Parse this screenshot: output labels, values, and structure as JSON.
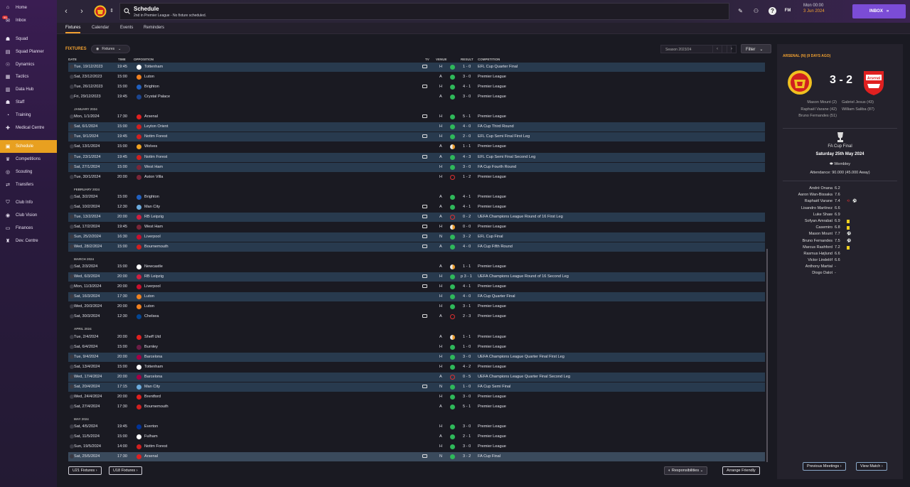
{
  "sidebar": {
    "items": [
      {
        "label": "Home",
        "icon": "home-icon",
        "glyph": "⌂"
      },
      {
        "label": "Inbox",
        "icon": "inbox-icon",
        "glyph": "✉"
      },
      {
        "label": "Squad",
        "icon": "squad-icon",
        "glyph": "☗"
      },
      {
        "label": "Squad Planner",
        "icon": "squad-planner-icon",
        "glyph": "▤"
      },
      {
        "label": "Dynamics",
        "icon": "dynamics-icon",
        "glyph": "☉"
      },
      {
        "label": "Tactics",
        "icon": "tactics-icon",
        "glyph": "▦"
      },
      {
        "label": "Data Hub",
        "icon": "data-hub-icon",
        "glyph": "▥"
      },
      {
        "label": "Staff",
        "icon": "staff-icon",
        "glyph": "☗"
      },
      {
        "label": "Training",
        "icon": "training-icon",
        "glyph": "◔"
      },
      {
        "label": "Medical Centre",
        "icon": "medical-icon",
        "glyph": "✚"
      },
      {
        "label": "Schedule",
        "icon": "calendar-icon",
        "glyph": "▣"
      },
      {
        "label": "Competitions",
        "icon": "trophy-icon",
        "glyph": "♛"
      },
      {
        "label": "Scouting",
        "icon": "scouting-icon",
        "glyph": "◎"
      },
      {
        "label": "Transfers",
        "icon": "transfers-icon",
        "glyph": "⇄"
      },
      {
        "label": "Club Info",
        "icon": "club-info-icon",
        "glyph": "⛉"
      },
      {
        "label": "Club Vision",
        "icon": "club-vision-icon",
        "glyph": "◉"
      },
      {
        "label": "Finances",
        "icon": "finances-icon",
        "glyph": "▭"
      },
      {
        "label": "Dev. Centre",
        "icon": "dev-centre-icon",
        "glyph": "♜"
      }
    ],
    "inbox_badge": "99"
  },
  "header": {
    "title": "Schedule",
    "subtitle": "2nd in Premier League - No fixture scheduled.",
    "date_time": "Mon 00:00",
    "date_day": "3 Jun 2024",
    "inbox_label": "INBOX",
    "fm_label": "FM"
  },
  "tabs": [
    "Fixtures",
    "Calendar",
    "Events",
    "Reminders"
  ],
  "fixtures": {
    "title": "FIXTURES",
    "dropdown": "Fixtures",
    "season": "Season 2023/24",
    "filter": "Filter",
    "columns": {
      "date": "DATE",
      "time": "TIME",
      "opposition": "OPPOSITION",
      "tv": "TV",
      "venue": "VENUE",
      "result": "RESULT",
      "competition": "COMPETITION"
    },
    "rows": [
      {
        "type": "row",
        "date": "Tue, 19/12/2023",
        "time": "19:45",
        "opp": "Tottenham",
        "crest": "#ffffff",
        "tv": true,
        "venue": "H",
        "res": "w",
        "score": "1 - 0",
        "comp": "EFL Cup Quarter Final",
        "hl": true
      },
      {
        "type": "row",
        "date": "Sat, 23/12/2023",
        "time": "15:00",
        "opp": "Luton",
        "crest": "#f08020",
        "tv": false,
        "venue": "A",
        "res": "w",
        "score": "3 - 0",
        "comp": "Premier League",
        "hl": false
      },
      {
        "type": "row",
        "date": "Tue, 26/12/2023",
        "time": "15:00",
        "opp": "Brighton",
        "crest": "#2060c0",
        "tv": true,
        "venue": "H",
        "res": "w",
        "score": "4 - 1",
        "comp": "Premier League",
        "hl": false
      },
      {
        "type": "row",
        "date": "Fri, 29/12/2023",
        "time": "19:45",
        "opp": "Crystal Palace",
        "crest": "#1b458f",
        "tv": false,
        "venue": "A",
        "res": "w",
        "score": "3 - 0",
        "comp": "Premier League",
        "hl": false
      },
      {
        "type": "month",
        "label": "JANUARY 2024"
      },
      {
        "type": "row",
        "date": "Mon, 1/1/2024",
        "time": "17:30",
        "opp": "Arsenal",
        "crest": "#e02020",
        "tv": true,
        "venue": "H",
        "res": "w",
        "score": "5 - 1",
        "comp": "Premier League",
        "hl": false
      },
      {
        "type": "row",
        "date": "Sat, 6/1/2024",
        "time": "15:00",
        "opp": "Leyton Orient",
        "crest": "#d02020",
        "tv": false,
        "venue": "H",
        "res": "w",
        "score": "4 - 0",
        "comp": "FA Cup Third Round",
        "hl": true
      },
      {
        "type": "row",
        "date": "Tue, 9/1/2024",
        "time": "19:45",
        "opp": "Nottm Forest",
        "crest": "#d02020",
        "tv": true,
        "venue": "H",
        "res": "w",
        "score": "2 - 0",
        "comp": "EFL Cup Semi Final First Leg",
        "hl": true
      },
      {
        "type": "row",
        "date": "Sat, 13/1/2024",
        "time": "15:00",
        "opp": "Wolves",
        "crest": "#f0a020",
        "tv": false,
        "venue": "A",
        "res": "d",
        "score": "1 - 1",
        "comp": "Premier League",
        "hl": false
      },
      {
        "type": "row",
        "date": "Tue, 23/1/2024",
        "time": "19:45",
        "opp": "Nottm Forest",
        "crest": "#d02020",
        "tv": true,
        "venue": "A",
        "res": "w",
        "score": "4 - 3",
        "comp": "EFL Cup Semi Final Second Leg",
        "hl": true
      },
      {
        "type": "row",
        "date": "Sat, 27/1/2024",
        "time": "15:00",
        "opp": "West Ham",
        "crest": "#7a2638",
        "tv": false,
        "venue": "H",
        "res": "w",
        "score": "3 - 0",
        "comp": "FA Cup Fourth Round",
        "hl": true
      },
      {
        "type": "row",
        "date": "Tue, 30/1/2024",
        "time": "20:00",
        "opp": "Aston Villa",
        "crest": "#7a2638",
        "tv": false,
        "venue": "H",
        "res": "l",
        "score": "1 - 2",
        "comp": "Premier League",
        "hl": false
      },
      {
        "type": "month",
        "label": "FEBRUARY 2024"
      },
      {
        "type": "row",
        "date": "Sat, 3/2/2024",
        "time": "15:00",
        "opp": "Brighton",
        "crest": "#2060c0",
        "tv": false,
        "venue": "A",
        "res": "w",
        "score": "4 - 1",
        "comp": "Premier League",
        "hl": false
      },
      {
        "type": "row",
        "date": "Sat, 10/2/2024",
        "time": "12:30",
        "opp": "Man City",
        "crest": "#6cabdd",
        "tv": true,
        "venue": "A",
        "res": "w",
        "score": "4 - 1",
        "comp": "Premier League",
        "hl": false
      },
      {
        "type": "row",
        "date": "Tue, 13/2/2024",
        "time": "20:00",
        "opp": "RB Leipzig",
        "crest": "#d02040",
        "tv": true,
        "venue": "A",
        "res": "l",
        "score": "0 - 2",
        "comp": "UEFA Champions League Round of 16 First Leg",
        "hl": true
      },
      {
        "type": "row",
        "date": "Sat, 17/2/2024",
        "time": "19:45",
        "opp": "West Ham",
        "crest": "#7a2638",
        "tv": true,
        "venue": "H",
        "res": "d",
        "score": "0 - 0",
        "comp": "Premier League",
        "hl": false
      },
      {
        "type": "row",
        "date": "Sun, 25/2/2024",
        "time": "16:30",
        "opp": "Liverpool",
        "crest": "#c8102e",
        "tv": true,
        "venue": "N",
        "res": "w",
        "score": "3 - 2",
        "comp": "EFL Cup Final",
        "hl": true
      },
      {
        "type": "row",
        "date": "Wed, 28/2/2024",
        "time": "15:00",
        "opp": "Bournemouth",
        "crest": "#d02020",
        "tv": true,
        "venue": "A",
        "res": "w",
        "score": "4 - 0",
        "comp": "FA Cup Fifth Round",
        "hl": true
      },
      {
        "type": "month",
        "label": "MARCH 2024"
      },
      {
        "type": "row",
        "date": "Sat, 2/3/2024",
        "time": "15:00",
        "opp": "Newcastle",
        "crest": "#ffffff",
        "tv": false,
        "venue": "A",
        "res": "d",
        "score": "1 - 1",
        "comp": "Premier League",
        "hl": false
      },
      {
        "type": "row",
        "date": "Wed, 6/3/2024",
        "time": "20:00",
        "opp": "RB Leipzig",
        "crest": "#d02040",
        "tv": true,
        "venue": "H",
        "res": "w",
        "score": "p 3 - 1",
        "comp": "UEFA Champions League Round of 16 Second Leg",
        "hl": true
      },
      {
        "type": "row",
        "date": "Mon, 11/3/2024",
        "time": "20:00",
        "opp": "Liverpool",
        "crest": "#c8102e",
        "tv": true,
        "venue": "H",
        "res": "w",
        "score": "4 - 1",
        "comp": "Premier League",
        "hl": false
      },
      {
        "type": "row",
        "date": "Sat, 16/3/2024",
        "time": "17:30",
        "opp": "Luton",
        "crest": "#f08020",
        "tv": false,
        "venue": "H",
        "res": "w",
        "score": "4 - 0",
        "comp": "FA Cup Quarter Final",
        "hl": true
      },
      {
        "type": "row",
        "date": "Wed, 20/3/2024",
        "time": "20:00",
        "opp": "Luton",
        "crest": "#f08020",
        "tv": false,
        "venue": "H",
        "res": "w",
        "score": "3 - 1",
        "comp": "Premier League",
        "hl": false
      },
      {
        "type": "row",
        "date": "Sat, 30/3/2024",
        "time": "12:30",
        "opp": "Chelsea",
        "crest": "#034694",
        "tv": true,
        "venue": "A",
        "res": "l",
        "score": "2 - 3",
        "comp": "Premier League",
        "hl": false
      },
      {
        "type": "month",
        "label": "APRIL 2024"
      },
      {
        "type": "row",
        "date": "Tue, 2/4/2024",
        "time": "20:00",
        "opp": "Sheff Utd",
        "crest": "#e02020",
        "tv": false,
        "venue": "A",
        "res": "d",
        "score": "1 - 1",
        "comp": "Premier League",
        "hl": false
      },
      {
        "type": "row",
        "date": "Sat, 6/4/2024",
        "time": "15:00",
        "opp": "Burnley",
        "crest": "#6c1d45",
        "tv": false,
        "venue": "H",
        "res": "w",
        "score": "1 - 0",
        "comp": "Premier League",
        "hl": false
      },
      {
        "type": "row",
        "date": "Tue, 9/4/2024",
        "time": "20:00",
        "opp": "Barcelona",
        "crest": "#a50044",
        "tv": false,
        "venue": "H",
        "res": "w",
        "score": "3 - 0",
        "comp": "UEFA Champions League Quarter Final First Leg",
        "hl": true
      },
      {
        "type": "row",
        "date": "Sat, 13/4/2024",
        "time": "15:00",
        "opp": "Tottenham",
        "crest": "#ffffff",
        "tv": false,
        "venue": "H",
        "res": "w",
        "score": "4 - 2",
        "comp": "Premier League",
        "hl": false
      },
      {
        "type": "row",
        "date": "Wed, 17/4/2024",
        "time": "20:00",
        "opp": "Barcelona",
        "crest": "#a50044",
        "tv": false,
        "venue": "A",
        "res": "l",
        "score": "0 - 5",
        "comp": "UEFA Champions League Quarter Final Second Leg",
        "hl": true
      },
      {
        "type": "row",
        "date": "Sat, 20/4/2024",
        "time": "17:15",
        "opp": "Man City",
        "crest": "#6cabdd",
        "tv": true,
        "venue": "N",
        "res": "w",
        "score": "1 - 0",
        "comp": "FA Cup Semi Final",
        "hl": true
      },
      {
        "type": "row",
        "date": "Wed, 24/4/2024",
        "time": "20:00",
        "opp": "Brentford",
        "crest": "#e02020",
        "tv": false,
        "venue": "H",
        "res": "w",
        "score": "3 - 0",
        "comp": "Premier League",
        "hl": false
      },
      {
        "type": "row",
        "date": "Sat, 27/4/2024",
        "time": "17:30",
        "opp": "Bournemouth",
        "crest": "#d02020",
        "tv": false,
        "venue": "A",
        "res": "w",
        "score": "5 - 1",
        "comp": "Premier League",
        "hl": false
      },
      {
        "type": "month",
        "label": "MAY 2024"
      },
      {
        "type": "row",
        "date": "Sat, 4/5/2024",
        "time": "19:45",
        "opp": "Everton",
        "crest": "#003399",
        "tv": false,
        "venue": "H",
        "res": "w",
        "score": "3 - 0",
        "comp": "Premier League",
        "hl": false
      },
      {
        "type": "row",
        "date": "Sat, 11/5/2024",
        "time": "15:00",
        "opp": "Fulham",
        "crest": "#ffffff",
        "tv": false,
        "venue": "A",
        "res": "w",
        "score": "2 - 1",
        "comp": "Premier League",
        "hl": false
      },
      {
        "type": "row",
        "date": "Sun, 19/5/2024",
        "time": "14:00",
        "opp": "Nottm Forest",
        "crest": "#d02020",
        "tv": false,
        "venue": "H",
        "res": "w",
        "score": "3 - 0",
        "comp": "Premier League",
        "hl": false
      },
      {
        "type": "row",
        "date": "Sat, 25/5/2024",
        "time": "17:30",
        "opp": "Arsenal",
        "crest": "#e02020",
        "tv": true,
        "venue": "N",
        "res": "w",
        "score": "3 - 2",
        "comp": "FA Cup Final",
        "hl": "sel"
      }
    ],
    "bottom": {
      "u21": "U21 Fixtures",
      "u18": "U18 Fixtures",
      "responsibilities": "Responsibilities",
      "arrange": "Arrange Friendly"
    }
  },
  "match": {
    "title": "ARSENAL (N) (9 DAYS AGO)",
    "score": "3 - 2",
    "home_crest_label": "MANCHESTER UNITED",
    "away_crest_label": "Arsenal",
    "home_scorers": [
      "Mason Mount (2)",
      "Raphaël Varane (42)",
      "Bruno Fernandes (51)"
    ],
    "away_scorers": [
      "Gabriel Jesus (43)",
      "William Saliba (87)"
    ],
    "competition": "FA Cup Final",
    "date": "Saturday 25th May 2024",
    "venue": "Wembley",
    "attendance": "Attendance: 90.000 (45.000 Away)",
    "ratings": [
      {
        "name": "André Onana",
        "rating": "6.2",
        "events": []
      },
      {
        "name": "Aaron Wan-Bissaka",
        "rating": "7.6",
        "events": []
      },
      {
        "name": "Raphaël Varane",
        "rating": "7.4",
        "events": [
          "sub-icon",
          "ball-icon"
        ]
      },
      {
        "name": "Lisandro Martínez",
        "rating": "6.6",
        "events": []
      },
      {
        "name": "Luke Shaw",
        "rating": "6.9",
        "events": []
      },
      {
        "name": "Sofyan Amrabat",
        "rating": "6.9",
        "events": [
          "yellow-card-icon"
        ]
      },
      {
        "name": "Casemiro",
        "rating": "6.8",
        "events": [
          "yellow-card-icon"
        ]
      },
      {
        "name": "Mason Mount",
        "rating": "7.7",
        "events": [
          "ball-icon"
        ]
      },
      {
        "name": "Bruno Fernandes",
        "rating": "7.5",
        "events": [
          "ball-icon"
        ]
      },
      {
        "name": "Marcus Rashford",
        "rating": "7.2",
        "events": [
          "yellow-card-icon"
        ]
      },
      {
        "name": "Rasmus Højlund",
        "rating": "6.6",
        "events": []
      },
      {
        "name": "Victor Lindelöf",
        "rating": "6.6",
        "events": []
      },
      {
        "name": "Anthony Martial",
        "rating": "-",
        "events": []
      },
      {
        "name": "Diogo Dalot",
        "rating": "-",
        "events": []
      }
    ],
    "prev_btn": "Previous Meetings",
    "view_btn": "View Match"
  }
}
